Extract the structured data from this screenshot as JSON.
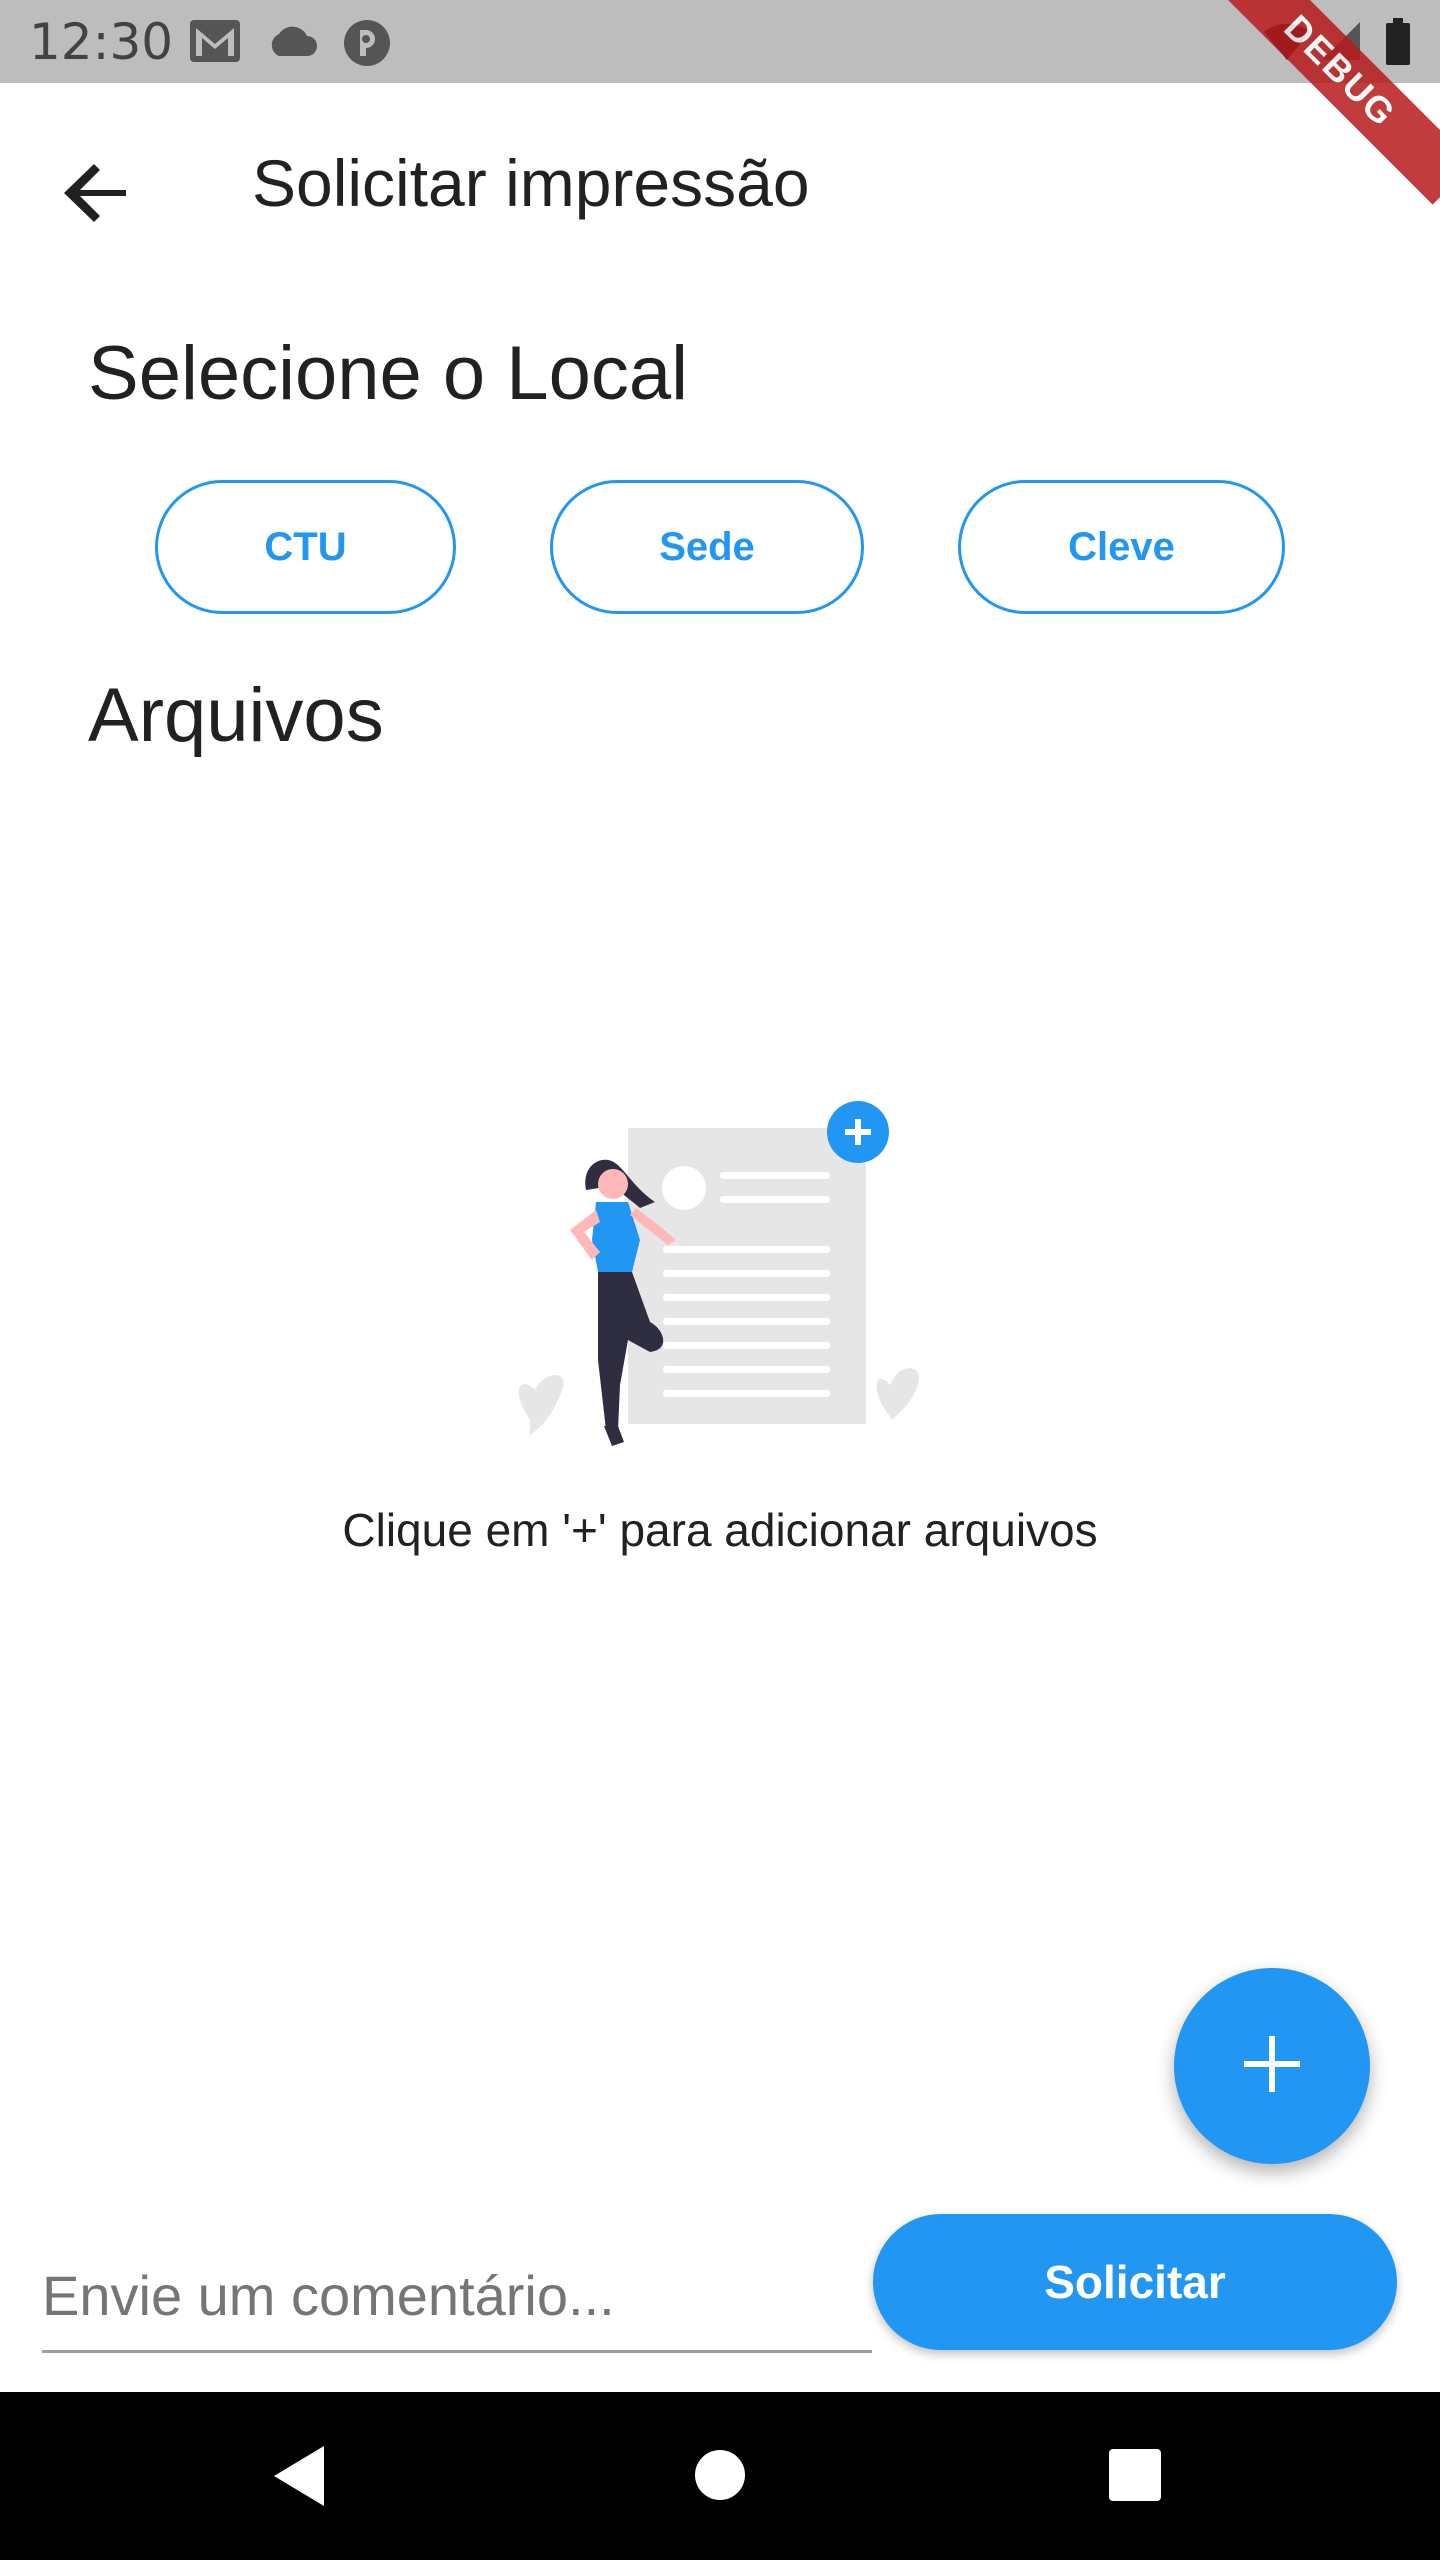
{
  "status_bar": {
    "time": "12:30",
    "icons": [
      "gmail-icon",
      "cloud-icon",
      "app-notification-icon",
      "wifi-icon",
      "signal-icon",
      "battery-icon"
    ],
    "debug_label": "DEBUG"
  },
  "app_bar": {
    "title": "Solicitar impressão",
    "back_icon": "arrow-back-icon"
  },
  "location_section": {
    "title": "Selecione o Local",
    "options": [
      "CTU",
      "Sede",
      "Cleve"
    ]
  },
  "files_section": {
    "title": "Arquivos",
    "empty_message": "Clique em '+' para adicionar arquivos",
    "illustration": "add-files-illustration"
  },
  "fab": {
    "icon": "plus-icon"
  },
  "bottom_bar": {
    "comment_placeholder": "Envie um comentário...",
    "comment_value": "",
    "submit_label": "Solicitar"
  },
  "nav_bar": {
    "icons": [
      "nav-back-icon",
      "nav-home-icon",
      "nav-recents-icon"
    ]
  },
  "colors": {
    "accent": "#2196f3",
    "status_bar": "#bdbdbd",
    "text": "#212121",
    "debug_banner": "#b71c1c"
  }
}
